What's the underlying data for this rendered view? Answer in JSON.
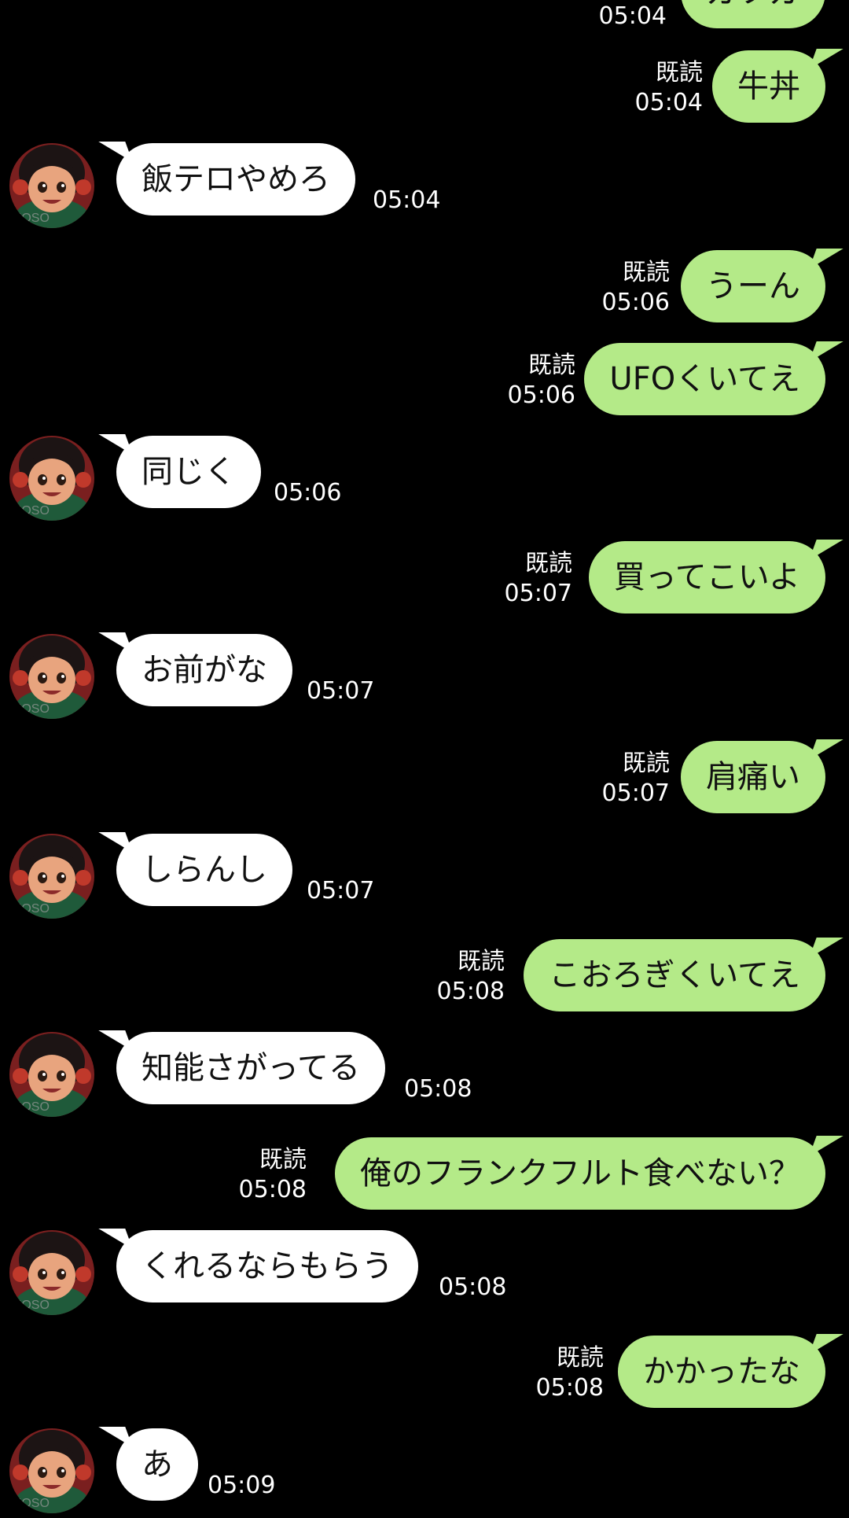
{
  "colors": {
    "background": "#000000",
    "outgoing_bubble": "#b4ea88",
    "incoming_bubble": "#ffffff",
    "meta_text": "#ffffff"
  },
  "avatar": {
    "icon": "cartoon-girl-avatar-icon",
    "watermark": "MOSO"
  },
  "top_partial": {
    "time": "05:04",
    "text": "ガツガ"
  },
  "messages": [
    {
      "dir": "out",
      "read": "既読",
      "time": "05:04",
      "text": "牛丼"
    },
    {
      "dir": "in",
      "time": "05:04",
      "text": "飯テロやめろ"
    },
    {
      "dir": "out",
      "read": "既読",
      "time": "05:06",
      "text": "うーん"
    },
    {
      "dir": "out",
      "read": "既読",
      "time": "05:06",
      "text": "UFOくいてえ"
    },
    {
      "dir": "in",
      "time": "05:06",
      "text": "同じく"
    },
    {
      "dir": "out",
      "read": "既読",
      "time": "05:07",
      "text": "買ってこいよ"
    },
    {
      "dir": "in",
      "time": "05:07",
      "text": "お前がな"
    },
    {
      "dir": "out",
      "read": "既読",
      "time": "05:07",
      "text": "肩痛い"
    },
    {
      "dir": "in",
      "time": "05:07",
      "text": "しらんし"
    },
    {
      "dir": "out",
      "read": "既読",
      "time": "05:08",
      "text": "こおろぎくいてえ"
    },
    {
      "dir": "in",
      "time": "05:08",
      "text": "知能さがってる"
    },
    {
      "dir": "out",
      "read": "既読",
      "time": "05:08",
      "text": "俺のフランクフルト食べない？"
    },
    {
      "dir": "in",
      "time": "05:08",
      "text": "くれるならもらう"
    },
    {
      "dir": "out",
      "read": "既読",
      "time": "05:08",
      "text": "かかったな"
    },
    {
      "dir": "in",
      "time": "05:09",
      "text": "あ"
    }
  ]
}
